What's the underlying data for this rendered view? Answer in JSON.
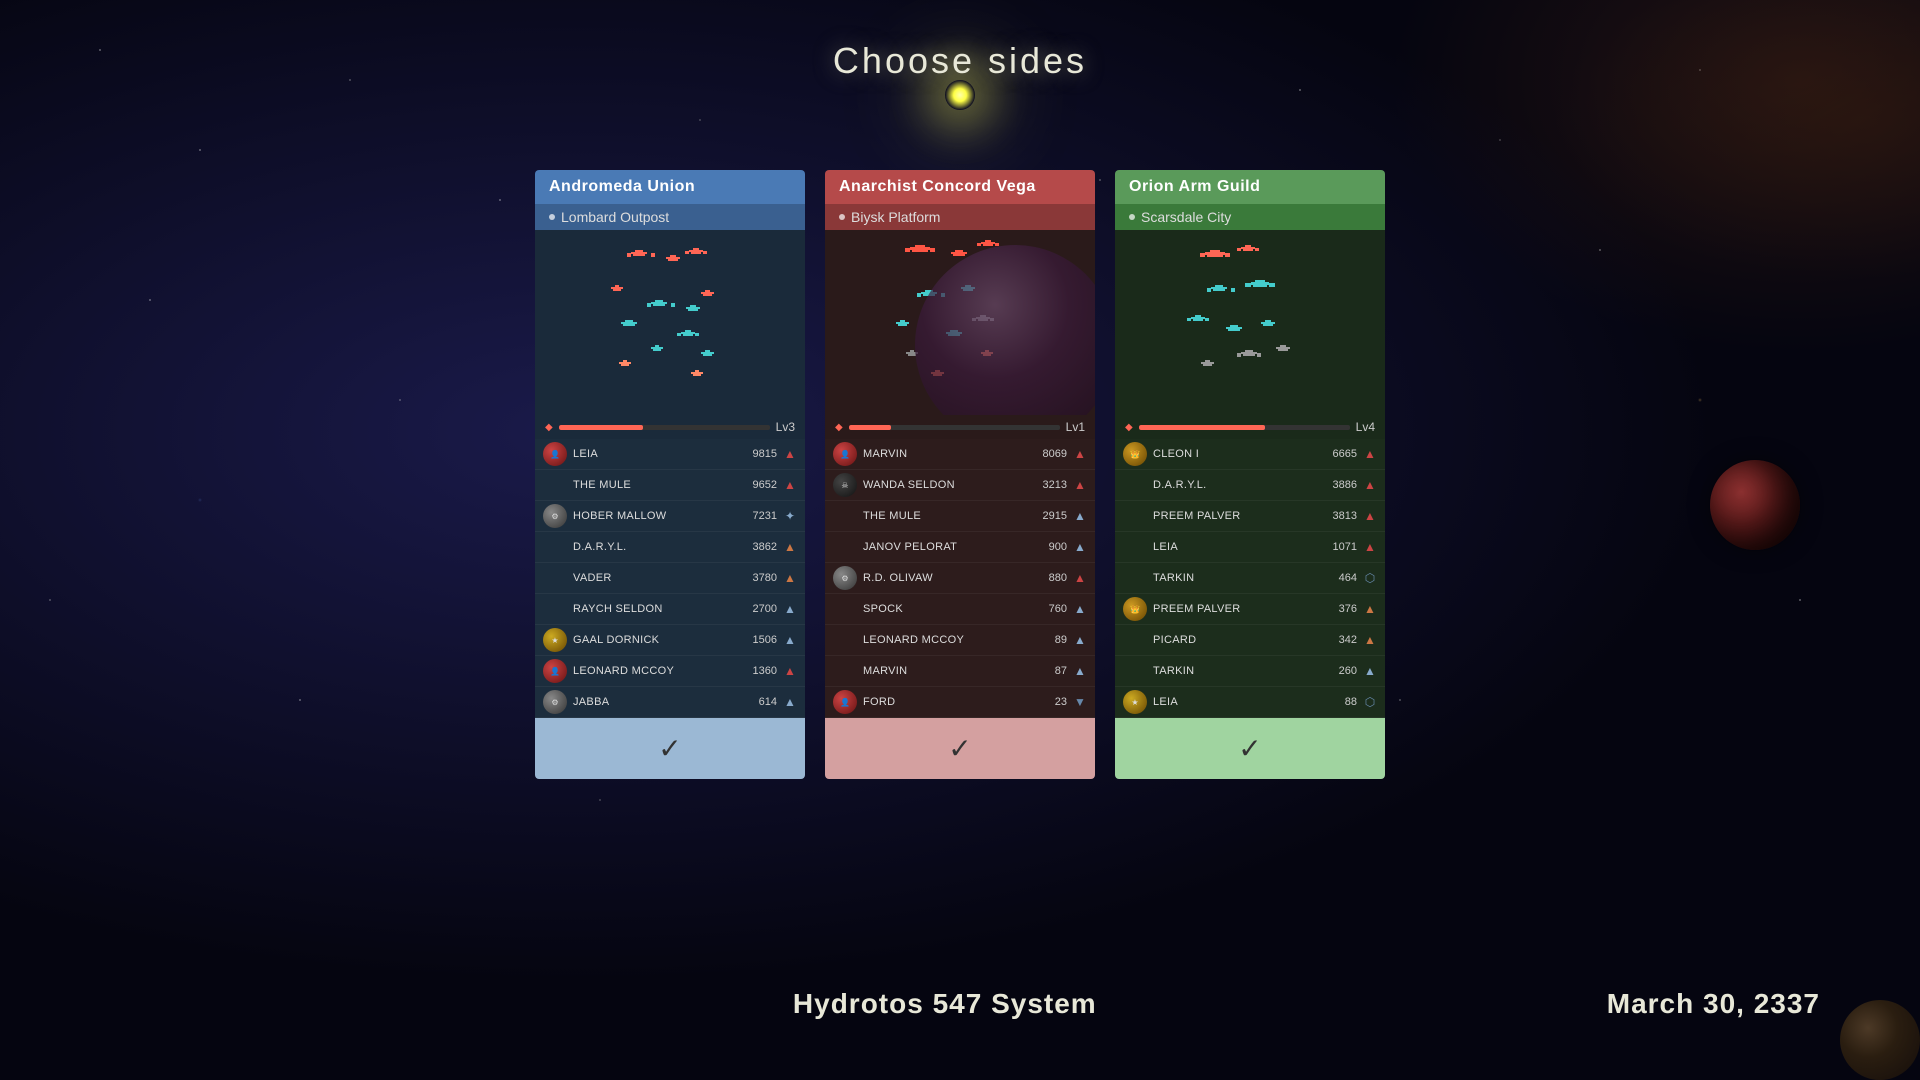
{
  "page": {
    "title": "Choose sides",
    "bottom_left": "Hydrotos 547 System",
    "bottom_right": "March 30, 2337"
  },
  "factions": [
    {
      "id": "andromeda",
      "name": "Andromeda Union",
      "location": "Lombard Outpost",
      "level": "Lv3",
      "level_pct": 40,
      "players": [
        {
          "name": "LEIA",
          "score": 9815,
          "has_avatar": true,
          "avatar_type": "red",
          "icon": "▲"
        },
        {
          "name": "THE MULE",
          "score": 9652,
          "has_avatar": false,
          "avatar_type": "",
          "icon": "▲"
        },
        {
          "name": "HOBER MALLOW",
          "score": 7231,
          "has_avatar": true,
          "avatar_type": "gray",
          "icon": "✦"
        },
        {
          "name": "D.A.R.Y.L.",
          "score": 3862,
          "has_avatar": false,
          "avatar_type": "",
          "icon": "⬆"
        },
        {
          "name": "VADER",
          "score": 3780,
          "has_avatar": false,
          "avatar_type": "",
          "icon": "⬆"
        },
        {
          "name": "RAYCH SELDON",
          "score": 2700,
          "has_avatar": false,
          "avatar_type": "",
          "icon": "▲"
        },
        {
          "name": "GAAL DORNICK",
          "score": 1506,
          "has_avatar": true,
          "avatar_type": "yellow-star",
          "icon": "▲"
        },
        {
          "name": "LEONARD MCCOY",
          "score": 1360,
          "has_avatar": true,
          "avatar_type": "red",
          "icon": "▲"
        },
        {
          "name": "JABBA",
          "score": 614,
          "has_avatar": true,
          "avatar_type": "gray",
          "icon": "▲"
        }
      ]
    },
    {
      "id": "anarchist",
      "name": "Anarchist Concord Vega",
      "location": "Biysk Platform",
      "level": "Lv1",
      "level_pct": 20,
      "players": [
        {
          "name": "MARVIN",
          "score": 8069,
          "has_avatar": true,
          "avatar_type": "red",
          "icon": "▲"
        },
        {
          "name": "WANDA SELDON",
          "score": 3213,
          "has_avatar": true,
          "avatar_type": "dark",
          "icon": "▲"
        },
        {
          "name": "THE MULE",
          "score": 2915,
          "has_avatar": false,
          "avatar_type": "",
          "icon": "▲"
        },
        {
          "name": "JANOV PELORAT",
          "score": 900,
          "has_avatar": false,
          "avatar_type": "",
          "icon": "▲"
        },
        {
          "name": "R.D. OLIVAW",
          "score": 880,
          "has_avatar": true,
          "avatar_type": "gray",
          "icon": "▲"
        },
        {
          "name": "SPOCK",
          "score": 760,
          "has_avatar": false,
          "avatar_type": "",
          "icon": "▲"
        },
        {
          "name": "LEONARD MCCOY",
          "score": 89,
          "has_avatar": false,
          "avatar_type": "",
          "icon": "▲"
        },
        {
          "name": "MARVIN",
          "score": 87,
          "has_avatar": false,
          "avatar_type": "",
          "icon": "▲"
        },
        {
          "name": "FORD",
          "score": 23,
          "has_avatar": true,
          "avatar_type": "red",
          "icon": "▼"
        }
      ]
    },
    {
      "id": "orion",
      "name": "Orion Arm Guild",
      "location": "Scarsdale City",
      "level": "Lv4",
      "level_pct": 60,
      "players": [
        {
          "name": "CLEON I",
          "score": 6665,
          "has_avatar": true,
          "avatar_type": "gold",
          "icon": "▲"
        },
        {
          "name": "D.A.R.Y.L.",
          "score": 3886,
          "has_avatar": false,
          "avatar_type": "",
          "icon": "▲"
        },
        {
          "name": "PREEM PALVER",
          "score": 3813,
          "has_avatar": false,
          "avatar_type": "",
          "icon": "▲"
        },
        {
          "name": "LEIA",
          "score": 1071,
          "has_avatar": false,
          "avatar_type": "",
          "icon": "▲"
        },
        {
          "name": "TARKIN",
          "score": 464,
          "has_avatar": false,
          "avatar_type": "",
          "icon": "⬡"
        },
        {
          "name": "PREEM PALVER",
          "score": 376,
          "has_avatar": true,
          "avatar_type": "gold",
          "icon": "⬆"
        },
        {
          "name": "PICARD",
          "score": 342,
          "has_avatar": false,
          "avatar_type": "",
          "icon": "⬆"
        },
        {
          "name": "TARKIN",
          "score": 260,
          "has_avatar": false,
          "avatar_type": "",
          "icon": "▲"
        },
        {
          "name": "LEIA",
          "score": 88,
          "has_avatar": true,
          "avatar_type": "yellow-star",
          "icon": "⬡"
        }
      ]
    }
  ],
  "checkmark": "✓"
}
